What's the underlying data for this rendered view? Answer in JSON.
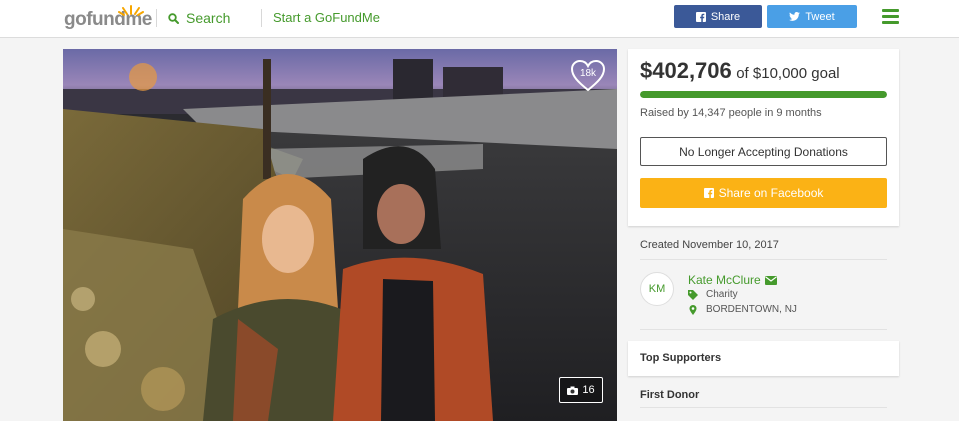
{
  "header": {
    "logo_text": "gofundme",
    "search_label": "Search",
    "start_label": "Start a GoFundMe",
    "share_label": "Share",
    "tweet_label": "Tweet"
  },
  "photo": {
    "likes": "18k",
    "photo_count": "16"
  },
  "donation": {
    "amount": "$402,706",
    "goal": "of $10,000 goal",
    "progress_percent": 100,
    "raised_by": "Raised by 14,347 people in 9 months",
    "no_longer_label": "No Longer Accepting Donations",
    "share_facebook_label": "Share on Facebook"
  },
  "campaign": {
    "created": "Created November 10, 2017",
    "organizer_initials": "KM",
    "organizer_name": "Kate McClure",
    "category": "Charity",
    "location": "BORDENTOWN, NJ"
  },
  "sections": {
    "top_supporters": "Top Supporters",
    "first_donor": "First Donor"
  },
  "colors": {
    "brand_green": "#459a2c",
    "facebook_blue": "#3b5998",
    "twitter_blue": "#4a9fe6",
    "share_yellow": "#fbb215"
  },
  "icons": [
    "search-icon",
    "facebook-icon",
    "twitter-icon",
    "menu-icon",
    "heart-icon",
    "camera-icon",
    "envelope-icon",
    "tag-icon",
    "map-pin-icon"
  ]
}
